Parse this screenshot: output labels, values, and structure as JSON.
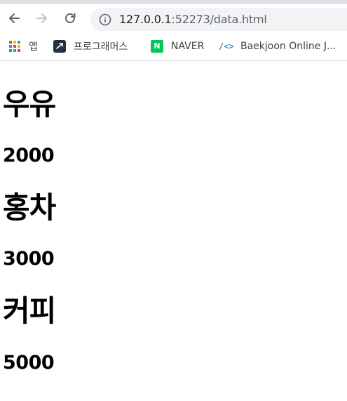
{
  "browser": {
    "url_host": "127.0.0.1",
    "url_path": ":52273/data.html",
    "icons": {
      "back": "arrow-left-icon",
      "forward": "arrow-right-icon",
      "reload": "reload-icon",
      "info": "info-icon"
    },
    "colors": {
      "toolbar_icon": "#5f6368",
      "forward_disabled": "#bdc1c6",
      "omnibox_bg": "#f1f3f4"
    }
  },
  "bookmarks": [
    {
      "label": "앱",
      "icon": "apps-grid-icon"
    },
    {
      "label": "프로그래머스",
      "icon": "programmers-icon"
    },
    {
      "label": "NAVER",
      "icon": "naver-icon",
      "icon_text": "N"
    },
    {
      "label": "Baekjoon Online J...",
      "icon": "code-brackets-icon",
      "icon_text": "/<>"
    }
  ],
  "items": [
    {
      "name": "우유",
      "price": "2000"
    },
    {
      "name": "홍차",
      "price": "3000"
    },
    {
      "name": "커피",
      "price": "5000"
    }
  ]
}
